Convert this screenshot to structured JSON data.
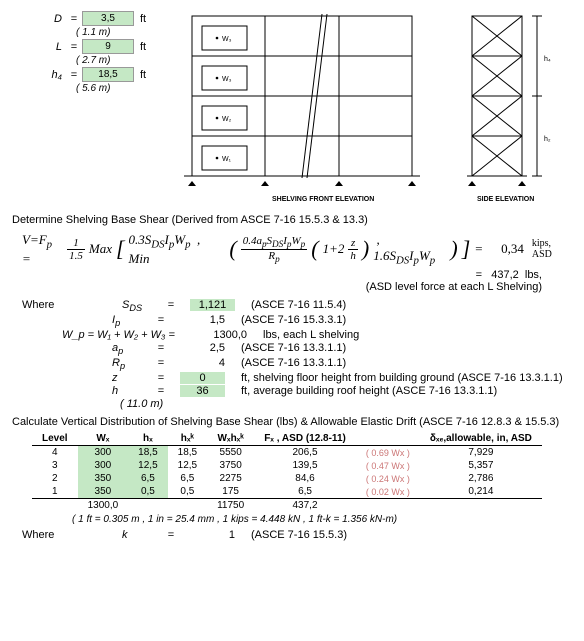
{
  "inputs": {
    "D": {
      "label": "D",
      "val": "3,5",
      "unit": "ft",
      "sub": "( 1.1 m)"
    },
    "L": {
      "label": "L",
      "val": "9",
      "unit": "ft",
      "sub": "( 2.7 m)"
    },
    "h4": {
      "label": "h₄",
      "val": "18,5",
      "unit": "ft",
      "sub": "( 5.6 m)"
    }
  },
  "diagram": {
    "w1": "W₁",
    "w2": "W₂",
    "w3": "W₃",
    "front": "SHELVING  FRONT  ELEVATION",
    "side": "SIDE  ELEVATION",
    "h4": "h₄",
    "h2": "h₂"
  },
  "sec1": "Determine Shelving Base Shear (Derived from ASCE 7-16 15.5.3 & 13.3)",
  "formula": {
    "lhs": "V=F_p =",
    "res1": "0,34",
    "res1u": "kips, ASD",
    "eq2a": "=",
    "eq2b": "437,2",
    "eq2c": "lbs,",
    "eq2d": "(ASD level force at each L Shelving)"
  },
  "whereLabel": "Where",
  "params": {
    "SDS": {
      "l": "S_DS",
      "e": "=",
      "v": "1,121",
      "g": true,
      "d": "(ASCE 7-16 11.5.4)"
    },
    "Ip": {
      "l": "I_p",
      "e": "=",
      "v": "1,5",
      "d": "(ASCE 7-16 15.3.3.1)"
    },
    "Wp": {
      "l": "W_p = W₁ + W₂ + W₃ =",
      "v": "1300,0",
      "d": "lbs, each L shelving",
      "full": true
    },
    "ap": {
      "l": "a_p",
      "e": "=",
      "v": "2,5",
      "d": "(ASCE 7-16 13.3.1.1)"
    },
    "Rp": {
      "l": "R_p",
      "e": "=",
      "v": "4",
      "d": "(ASCE 7-16 13.3.1.1)"
    },
    "z": {
      "l": "z",
      "e": "=",
      "v": "0",
      "g": true,
      "d": "ft, shelving floor height from building ground (ASCE 7-16 13.3.1.1)"
    },
    "h": {
      "l": "h",
      "e": "=",
      "v": "36",
      "g": true,
      "d": "ft, average building roof height (ASCE 7-16 13.3.1.1)",
      "sub": "( 11.0 m)"
    }
  },
  "sec2": "Calculate Vertical Distribution of Shelving Base Shear (lbs) & Allowable Elastic Drift (ASCE 7-16 12.8.3 & 15.5.3)",
  "table": {
    "headers": [
      "Level",
      "Wₓ",
      "hₓ",
      "hₓᵏ",
      "Wₓhₓᵏ",
      "Fₓ , ASD (12.8-11)",
      "",
      "δₓₑ,allowable, in, ASD"
    ],
    "rows": [
      {
        "lvl": "4",
        "wx": "300",
        "hx": "18,5",
        "hxk": "18,5",
        "wh": "5550",
        "fx": "206,5",
        "p": "( 0.69 Wx )",
        "d": "7,929"
      },
      {
        "lvl": "3",
        "wx": "300",
        "hx": "12,5",
        "hxk": "12,5",
        "wh": "3750",
        "fx": "139,5",
        "p": "( 0.47 Wx )",
        "d": "5,357"
      },
      {
        "lvl": "2",
        "wx": "350",
        "hx": "6,5",
        "hxk": "6,5",
        "wh": "2275",
        "fx": "84,6",
        "p": "( 0.24 Wx )",
        "d": "2,786"
      },
      {
        "lvl": "1",
        "wx": "350",
        "hx": "0,5",
        "hxk": "0,5",
        "wh": "175",
        "fx": "6,5",
        "p": "( 0.02 Wx )",
        "d": "0,214"
      }
    ],
    "totWx": "1300,0",
    "totWh": "11750",
    "totFx": "437,2",
    "note": "( 1 ft = 0.305 m ,   1 in = 25.4 mm ,   1 kips = 4.448 kN ,   1 ft-k = 1.356 kN-m)"
  },
  "where2": {
    "k": {
      "l": "k",
      "e": "=",
      "v": "1",
      "d": "(ASCE 7-16 15.5.3)"
    }
  }
}
